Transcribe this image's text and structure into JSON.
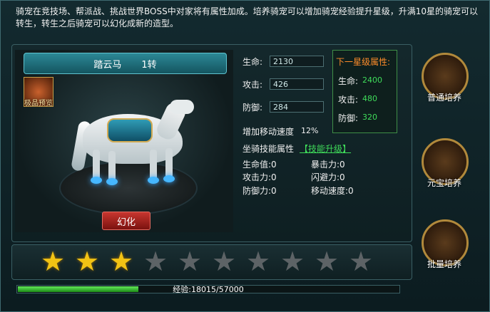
{
  "description": "骑宠在竞技场、帮派战、挑战世界BOSS中对家将有属性加成。培养骑宠可以增加骑宠经验提升星级，升满10星的骑宠可以转生，转生之后骑宠可以幻化成新的造型。",
  "mount": {
    "name": "踏云马",
    "tier": "1转",
    "rare_preview": "极品预览",
    "transform_button": "幻化"
  },
  "stats": {
    "hp_label": "生命:",
    "hp": "2130",
    "atk_label": "攻击:",
    "atk": "426",
    "def_label": "防御:",
    "def": "284",
    "move_label": "增加移动速度",
    "move": "12%"
  },
  "next_star": {
    "title": "下一星级属性:",
    "hp_label": "生命:",
    "hp": "2400",
    "atk_label": "攻击:",
    "atk": "480",
    "def_label": "防御:",
    "def": "320"
  },
  "skill": {
    "label": "坐骑技能属性",
    "upgrade_link": "【技能升级】",
    "attrs": [
      {
        "label": "生命值:",
        "value": "0"
      },
      {
        "label": "暴击力:",
        "value": "0"
      },
      {
        "label": "攻击力:",
        "value": "0"
      },
      {
        "label": "闪避力:",
        "value": "0"
      },
      {
        "label": "防御力:",
        "value": "0"
      },
      {
        "label": "移动速度:",
        "value": "0"
      }
    ]
  },
  "side_buttons": [
    {
      "label": "普通培养"
    },
    {
      "label": "元宝培养"
    },
    {
      "label": "批量培养"
    }
  ],
  "stars": {
    "lit": 3,
    "total": 10
  },
  "xp": {
    "text": "经验:18015/57000",
    "current": 18015,
    "max": 57000
  },
  "colors": {
    "star_lit": "#f2c314",
    "star_dim": "#5d6366",
    "xp_green": "#3fdc5a",
    "accent_orange": "#ff8c2a"
  }
}
